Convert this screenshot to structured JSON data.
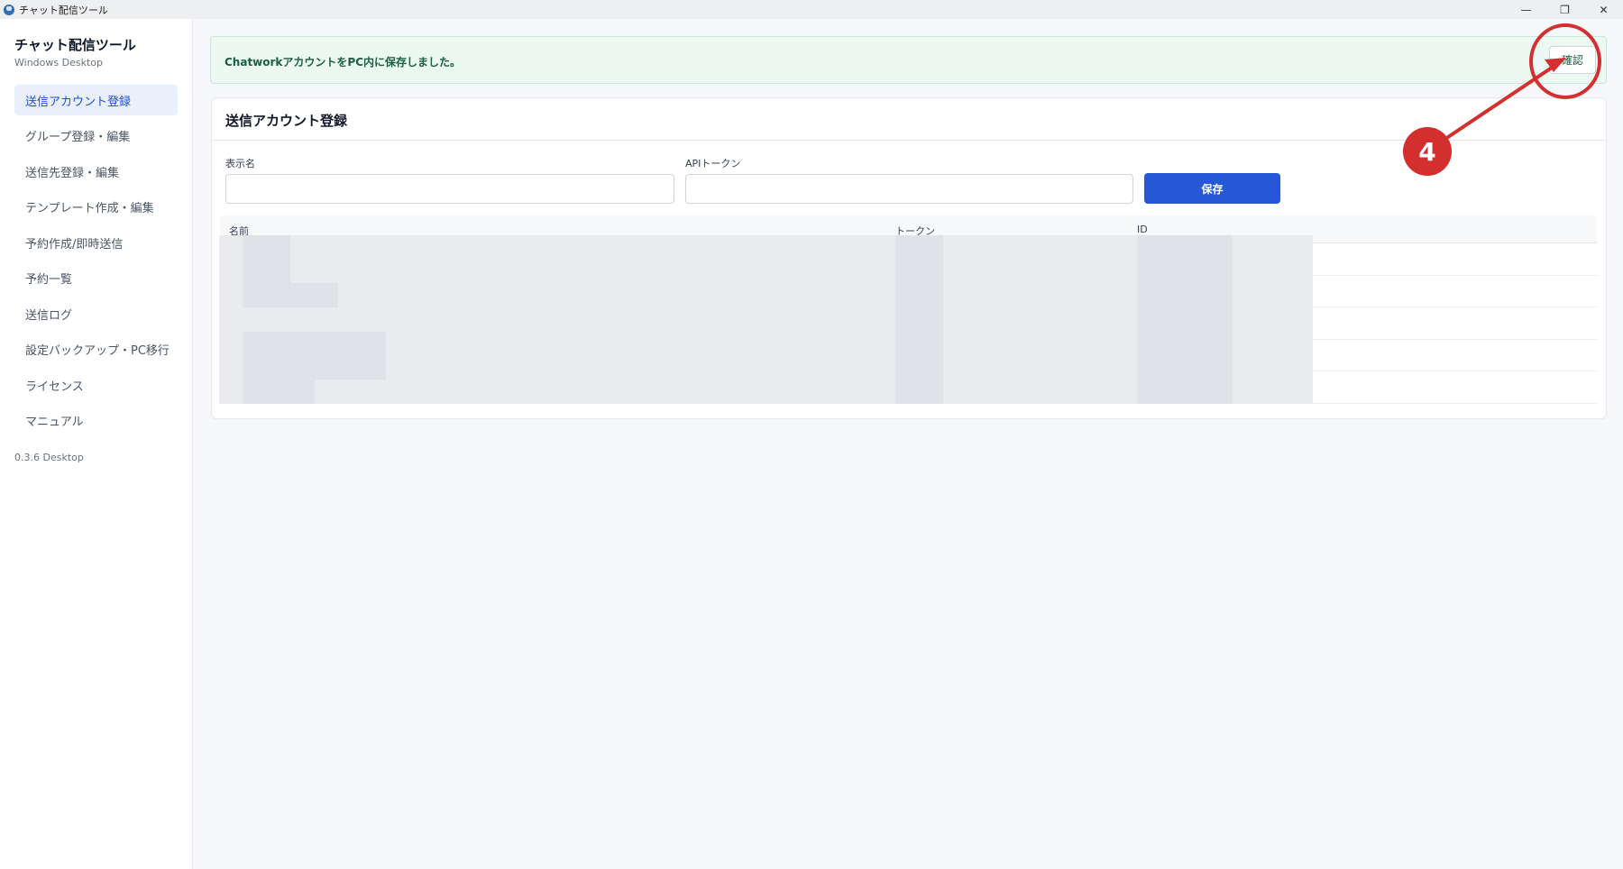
{
  "window": {
    "title": "チャット配信ツール",
    "minimize": "—",
    "maximize": "❐",
    "close": "✕"
  },
  "sidebar": {
    "brand_title": "チャット配信ツール",
    "brand_sub": "Windows Desktop",
    "items": [
      {
        "label": "送信アカウント登録",
        "active": true
      },
      {
        "label": "グループ登録・編集"
      },
      {
        "label": "送信先登録・編集"
      },
      {
        "label": "テンプレート作成・編集"
      },
      {
        "label": "予約作成/即時送信"
      },
      {
        "label": "予約一覧"
      },
      {
        "label": "送信ログ"
      },
      {
        "label": "設定バックアップ・PC移行"
      },
      {
        "label": "ライセンス"
      },
      {
        "label": "マニュアル"
      }
    ],
    "version": "0.3.6 Desktop"
  },
  "alert": {
    "message": "ChatworkアカウントをPC内に保存しました。",
    "confirm_label": "確認"
  },
  "form": {
    "title": "送信アカウント登録",
    "display_name_label": "表示名",
    "display_name_value": "",
    "api_token_label": "APIトークン",
    "api_token_value": "",
    "save_label": "保存"
  },
  "table": {
    "headers": [
      "名前",
      "トークン",
      "ID"
    ],
    "rows": 5
  },
  "annotation": {
    "step": "4",
    "color": "#d32f2f"
  }
}
